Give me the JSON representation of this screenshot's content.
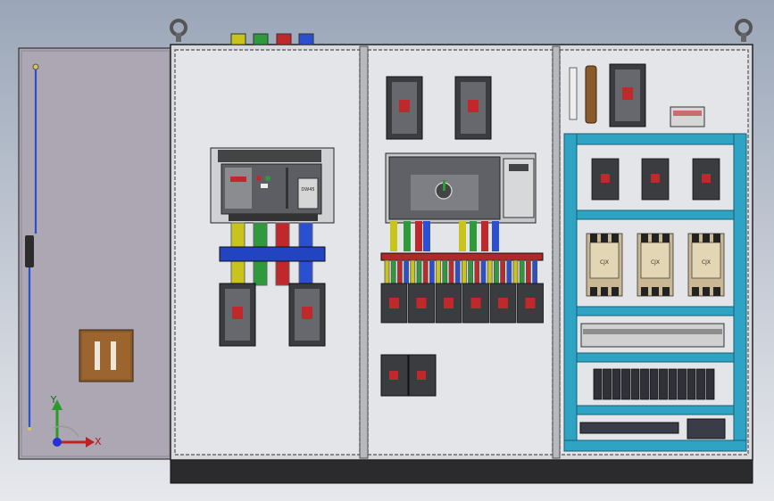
{
  "scene": {
    "axes": {
      "x_label": "X",
      "y_label": "Y"
    },
    "breaker_label": "DW45",
    "contactor_label": "CJX",
    "colors": {
      "background_top": "#9aa6b8",
      "cabinet_panel": "#e3e5e8",
      "door": "#aca7b3",
      "phase_yellow": "#c9c41c",
      "phase_green": "#2e9a3c",
      "phase_red": "#c0282c",
      "neutral_blue": "#2a4fd0",
      "din_rail_frame": "#2fa3c4",
      "busbar_blue": "#2244c0",
      "busbar_red": "#b02828"
    }
  }
}
